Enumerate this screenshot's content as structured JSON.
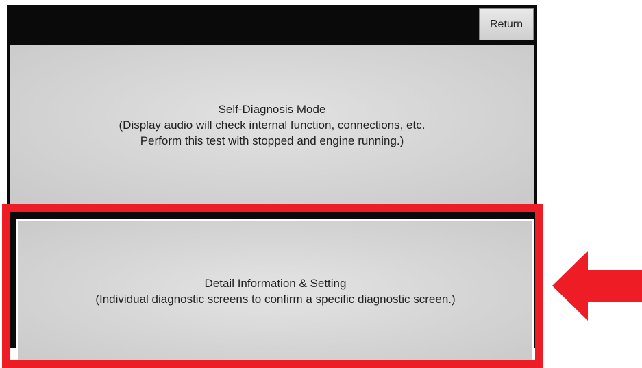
{
  "header": {
    "return_label": "Return"
  },
  "menu": {
    "self_diagnosis": {
      "title": "Self-Diagnosis Mode",
      "line1": "(Display audio will check internal function, connections, etc.",
      "line2": "Perform this test with stopped and engine running.)"
    },
    "detail_info": {
      "title": "Detail Information & Setting",
      "line1": "(Individual diagnostic screens to confirm a specific diagnostic screen.)"
    }
  },
  "annotation": {
    "highlight_color": "#ee1c24",
    "arrow_icon": "left-arrow-icon"
  }
}
